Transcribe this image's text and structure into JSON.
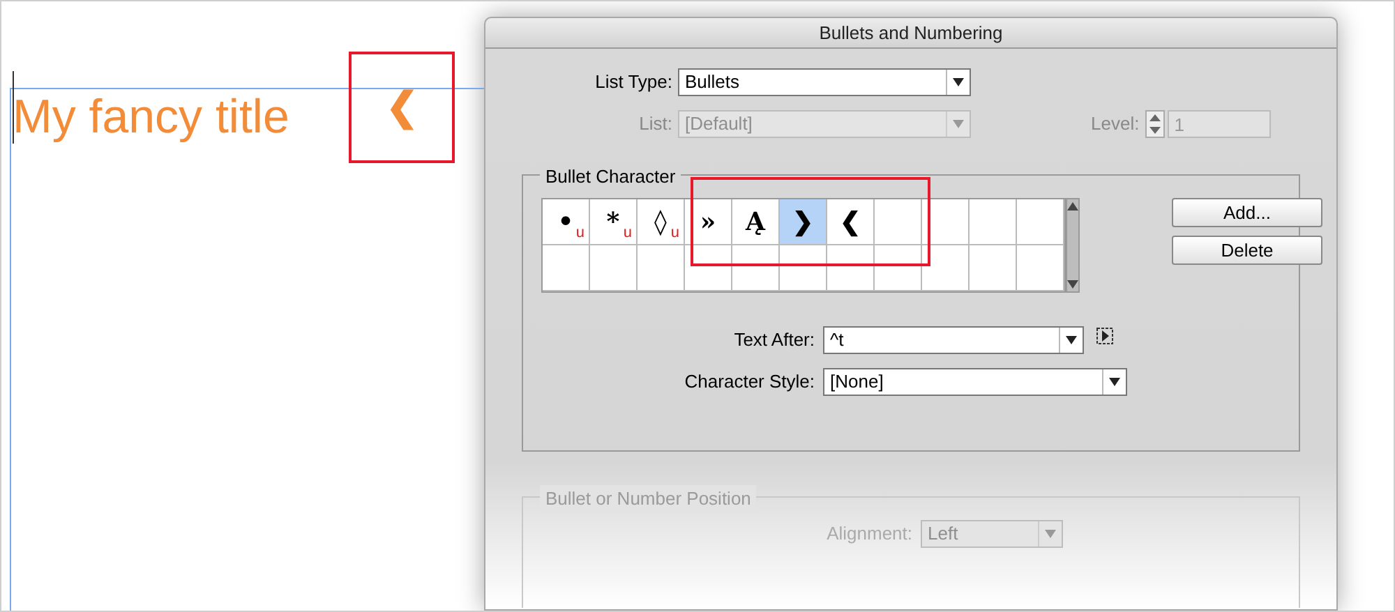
{
  "document": {
    "title": "My fancy title",
    "preview_glyph": "❮"
  },
  "dialog": {
    "title": "Bullets and Numbering",
    "list_type": {
      "label": "List Type:",
      "value": "Bullets",
      "disabled": false
    },
    "list": {
      "label": "List:",
      "value": "[Default]",
      "disabled": true
    },
    "level": {
      "label": "Level:",
      "value": "1",
      "disabled": true
    },
    "bullet_character": {
      "legend": "Bullet Character",
      "cells": [
        {
          "glyph": "•",
          "unicode_mark": "u",
          "selected": false
        },
        {
          "glyph": "*",
          "unicode_mark": "u",
          "selected": false
        },
        {
          "glyph": "◊",
          "unicode_mark": "u",
          "selected": false
        },
        {
          "glyph": "»",
          "selected": false
        },
        {
          "glyph": "Ą",
          "selected": false
        },
        {
          "glyph": "❯",
          "selected": true
        },
        {
          "glyph": "❮",
          "selected": false
        }
      ],
      "buttons": [
        "Add...",
        "Delete"
      ],
      "text_after": {
        "label": "Text After:",
        "value": "^t"
      },
      "character_style": {
        "label": "Character Style:",
        "value": "[None]"
      }
    },
    "position": {
      "legend": "Bullet or Number Position",
      "alignment": {
        "label": "Alignment:",
        "value": "Left",
        "disabled": true
      }
    }
  }
}
